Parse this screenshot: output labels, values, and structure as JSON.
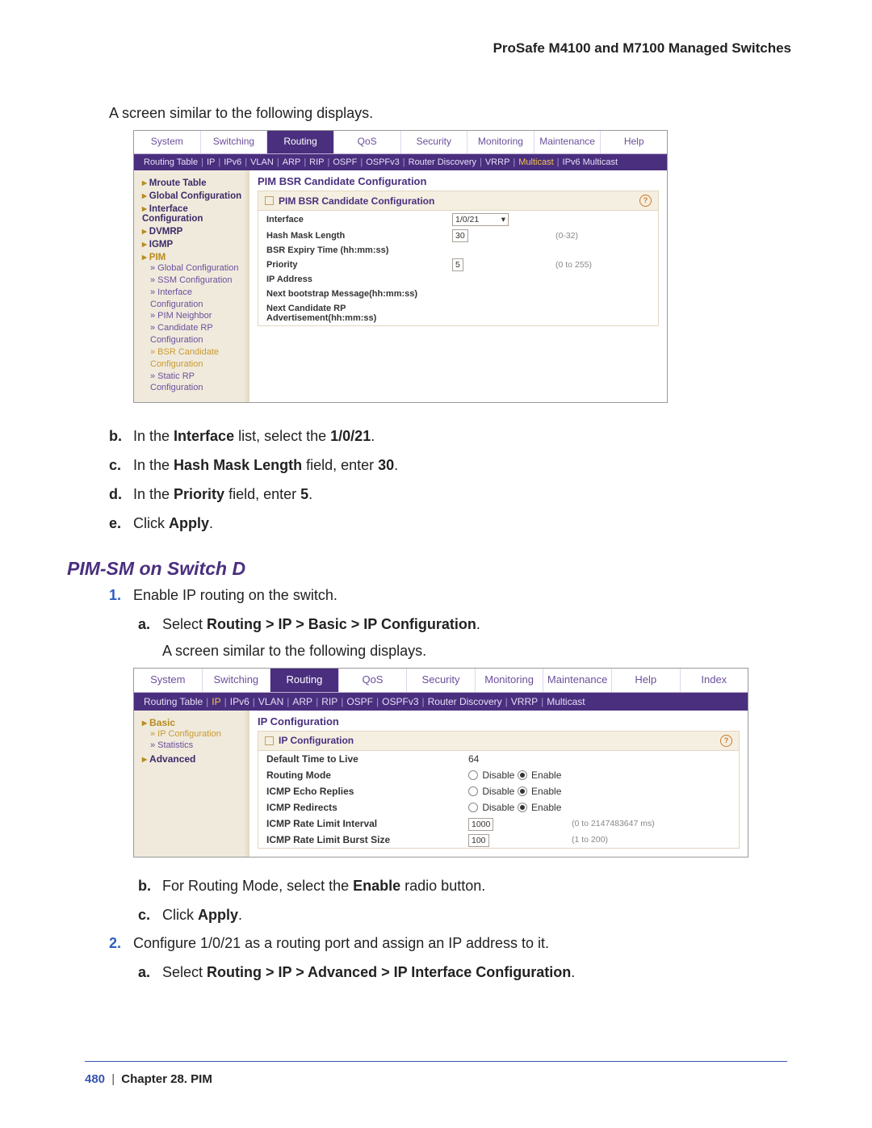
{
  "page_header": "ProSafe M4100 and M7100 Managed Switches",
  "intro1": "A screen similar to the following displays.",
  "shot1": {
    "tabs": [
      "System",
      "Switching",
      "Routing",
      "QoS",
      "Security",
      "Monitoring",
      "Maintenance",
      "Help"
    ],
    "active_tab": "Routing",
    "subtabs": [
      "Routing Table",
      "IP",
      "IPv6",
      "VLAN",
      "ARP",
      "RIP",
      "OSPF",
      "OSPFv3",
      "Router Discovery",
      "VRRP",
      "Multicast",
      "IPv6 Multicast"
    ],
    "subtab_hl": "Multicast",
    "nav": [
      {
        "type": "grp",
        "txt": "Mroute Table"
      },
      {
        "type": "grp",
        "txt": "Global Configuration"
      },
      {
        "type": "grp",
        "txt": "Interface Configuration"
      },
      {
        "type": "grp",
        "txt": "DVMRP"
      },
      {
        "type": "grp",
        "txt": "IGMP"
      },
      {
        "type": "grp",
        "cls": "gold",
        "txt": "PIM"
      },
      {
        "type": "lnk",
        "txt": "Global Configuration"
      },
      {
        "type": "lnk",
        "txt": "SSM Configuration"
      },
      {
        "type": "lnk",
        "txt": "Interface Configuration"
      },
      {
        "type": "lnk",
        "txt": "PIM Neighbor"
      },
      {
        "type": "lnk",
        "txt": "Candidate RP Configuration"
      },
      {
        "type": "lnk",
        "cls": "sel",
        "txt": "BSR Candidate Configuration"
      },
      {
        "type": "lnk",
        "txt": "Static RP Configuration"
      }
    ],
    "panel_title": "PIM BSR Candidate Configuration",
    "panel_box_title": "PIM BSR Candidate Configuration",
    "rows": [
      {
        "lbl": "Interface",
        "ctrl": "select",
        "val": "1/0/21"
      },
      {
        "lbl": "Hash Mask Length",
        "ctrl": "input",
        "val": "30",
        "hint": "(0-32)"
      },
      {
        "lbl": "BSR Expiry Time (hh:mm:ss)"
      },
      {
        "lbl": "Priority",
        "ctrl": "input",
        "val": "5",
        "hint": "(0 to 255)"
      },
      {
        "lbl": "IP Address"
      },
      {
        "lbl": "Next bootstrap Message(hh:mm:ss)"
      },
      {
        "lbl": "Next Candidate RP Advertisement(hh:mm:ss)"
      }
    ]
  },
  "steps_after_shot1": [
    {
      "m": "b.",
      "html": "In the <b>Interface</b> list, select the <b>1/0/21</b>."
    },
    {
      "m": "c.",
      "html": "In the <b>Hash Mask Length</b> field, enter <b>30</b>."
    },
    {
      "m": "d.",
      "html": "In the <b>Priority</b> field, enter <b>5</b>."
    },
    {
      "m": "e.",
      "html": "Click <b>Apply</b>."
    }
  ],
  "section2_heading": "PIM-SM on Switch D",
  "section2_prelist": [
    {
      "m": "1.",
      "cls": "blue",
      "html": "Enable IP routing on the switch."
    },
    {
      "m": "a.",
      "sub": true,
      "html": "Select <b>Routing &gt; IP &gt; Basic &gt; IP Configuration</b>."
    }
  ],
  "intro2": "A screen similar to the following displays.",
  "shot2": {
    "tabs": [
      "System",
      "Switching",
      "Routing",
      "QoS",
      "Security",
      "Monitoring",
      "Maintenance",
      "Help",
      "Index"
    ],
    "active_tab": "Routing",
    "subtabs": [
      "Routing Table",
      "IP",
      "IPv6",
      "VLAN",
      "ARP",
      "RIP",
      "OSPF",
      "OSPFv3",
      "Router Discovery",
      "VRRP",
      "Multicast"
    ],
    "subtab_hl": "IP",
    "nav": [
      {
        "type": "grp",
        "cls": "gold",
        "txt": "Basic"
      },
      {
        "type": "lnk",
        "cls": "sel",
        "txt": "IP Configuration"
      },
      {
        "type": "lnk",
        "txt": "Statistics"
      },
      {
        "type": "grp",
        "txt": "Advanced"
      }
    ],
    "panel_title": "IP Configuration",
    "panel_box_title": "IP Configuration",
    "rows": [
      {
        "lbl": "Default Time to Live",
        "ctrl": "text",
        "val": "64"
      },
      {
        "lbl": "Routing Mode",
        "ctrl": "radio",
        "val": [
          "Disable",
          "Enable"
        ],
        "sel": 1
      },
      {
        "lbl": "ICMP Echo Replies",
        "ctrl": "radio",
        "val": [
          "Disable",
          "Enable"
        ],
        "sel": 1
      },
      {
        "lbl": "ICMP Redirects",
        "ctrl": "radio",
        "val": [
          "Disable",
          "Enable"
        ],
        "sel": 1
      },
      {
        "lbl": "ICMP Rate Limit Interval",
        "ctrl": "input",
        "val": "1000",
        "hint": "(0 to 2147483647 ms)"
      },
      {
        "lbl": "ICMP Rate Limit Burst Size",
        "ctrl": "input",
        "val": "100",
        "hint": "(1 to 200)"
      }
    ]
  },
  "steps_after_shot2": [
    {
      "m": "b.",
      "sub": true,
      "html": "For Routing Mode, select the <b>Enable</b> radio button."
    },
    {
      "m": "c.",
      "sub": true,
      "html": "Click <b>Apply</b>."
    },
    {
      "m": "2.",
      "cls": "blue",
      "html": "Configure 1/0/21 as a routing port and assign an IP address to it."
    },
    {
      "m": "a.",
      "sub": true,
      "html": "Select <b>Routing &gt; IP &gt; Advanced &gt; IP Interface Configuration</b>."
    }
  ],
  "footer": {
    "page": "480",
    "sep": "|",
    "chapter": "Chapter 28.  PIM"
  }
}
